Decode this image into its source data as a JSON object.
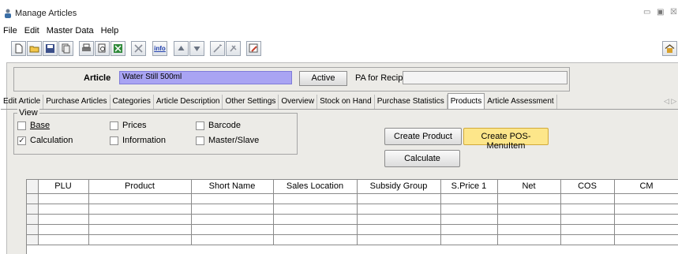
{
  "window": {
    "title": "Manage Articles",
    "controls": [
      "▭",
      "▣",
      "☒"
    ]
  },
  "menu": [
    "File",
    "Edit",
    "Master Data",
    "Help"
  ],
  "toolbar": {
    "buttons": [
      "new-document-icon",
      "open-folder-icon",
      "save-icon",
      "copy-icon",
      "print-icon",
      "print-preview-icon",
      "export-excel-icon",
      "delete-icon",
      "info-icon",
      "arrow-up-icon",
      "arrow-down-icon",
      "magic-wand-icon",
      "tools-icon",
      "edit-icon"
    ],
    "info_label": "info"
  },
  "header": {
    "article_label": "Article",
    "article_value": "Water Still 500ml",
    "active_button": "Active",
    "pa_label": "PA for Recipe:",
    "pa_value": ""
  },
  "tabs": [
    "Edit Article",
    "Purchase Articles",
    "Categories",
    "Article Description",
    "Other Settings",
    "Overview",
    "Stock on Hand",
    "Purchase Statistics",
    "Products",
    "Article Assessment"
  ],
  "active_tab": "Products",
  "view": {
    "legend": "View",
    "options": [
      {
        "label": "Base",
        "checked": false
      },
      {
        "label": "Prices",
        "checked": false
      },
      {
        "label": "Barcode",
        "checked": false
      },
      {
        "label": "Calculation",
        "checked": true
      },
      {
        "label": "Information",
        "checked": false
      },
      {
        "label": "Master/Slave",
        "checked": false
      }
    ]
  },
  "actions": {
    "create_product": "Create Product",
    "create_pos": "Create POS-MenuItem",
    "calculate": "Calculate"
  },
  "grid": {
    "columns": [
      "PLU",
      "Product",
      "Short Name",
      "Sales Location",
      "Subsidy Group",
      "S.Price 1",
      "Net",
      "COS",
      "CM"
    ],
    "rows": 5
  },
  "colors": {
    "article_field": "#a9a4f3",
    "highlight_button": "#fde68a"
  }
}
